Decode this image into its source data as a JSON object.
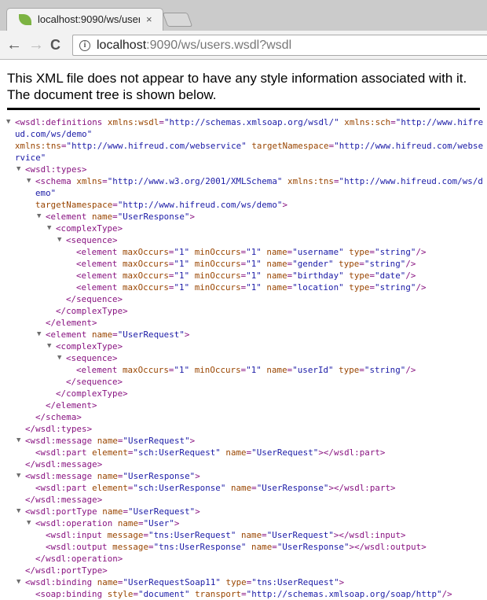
{
  "browser": {
    "tab_title": "localhost:9090/ws/user",
    "tab_close": "×",
    "back_icon": "←",
    "forward_icon": "→",
    "reload_icon": "C",
    "url_host": "localhost",
    "url_rest": ":9090/ws/users.wsdl?wsdl",
    "info_icon": "i"
  },
  "notice": "This XML file does not appear to have any style information associated with it. The document tree is shown below.",
  "colors": {
    "tag": "#881280",
    "attr": "#994500",
    "value": "#1a1aa6"
  },
  "xml_lines": [
    {
      "d": 0,
      "o": 1,
      "p": [
        [
          "tag",
          "<wsdl:definitions "
        ],
        [
          "attr",
          "xmlns:wsdl"
        ],
        [
          "tag",
          "="
        ],
        [
          "val",
          "\"http://schemas.xmlsoap.org/wsdl/\""
        ],
        [
          "tag",
          " "
        ],
        [
          "attr",
          "xmlns:sch"
        ],
        [
          "tag",
          "="
        ],
        [
          "val",
          "\"http://www.hifreud.com/ws/demo\""
        ]
      ]
    },
    {
      "d": 0,
      "p": [
        [
          "attr",
          "xmlns:tns"
        ],
        [
          "tag",
          "="
        ],
        [
          "val",
          "\"http://www.hifreud.com/webservice\""
        ],
        [
          "tag",
          " "
        ],
        [
          "attr",
          "targetNamespace"
        ],
        [
          "tag",
          "="
        ],
        [
          "val",
          "\"http://www.hifreud.com/webservice\""
        ]
      ]
    },
    {
      "d": 1,
      "o": 1,
      "p": [
        [
          "tag",
          "<wsdl:types>"
        ]
      ]
    },
    {
      "d": 2,
      "o": 1,
      "p": [
        [
          "tag",
          "<schema "
        ],
        [
          "attr",
          "xmlns"
        ],
        [
          "tag",
          "="
        ],
        [
          "val",
          "\"http://www.w3.org/2001/XMLSchema\""
        ],
        [
          "tag",
          " "
        ],
        [
          "attr",
          "xmlns:tns"
        ],
        [
          "tag",
          "="
        ],
        [
          "val",
          "\"http://www.hifreud.com/ws/demo\""
        ]
      ]
    },
    {
      "d": 2,
      "p": [
        [
          "attr",
          "targetNamespace"
        ],
        [
          "tag",
          "="
        ],
        [
          "val",
          "\"http://www.hifreud.com/ws/demo\""
        ],
        [
          "tag",
          ">"
        ]
      ]
    },
    {
      "d": 3,
      "o": 1,
      "p": [
        [
          "tag",
          "<element "
        ],
        [
          "attr",
          "name"
        ],
        [
          "tag",
          "="
        ],
        [
          "val",
          "\"UserResponse\""
        ],
        [
          "tag",
          ">"
        ]
      ]
    },
    {
      "d": 4,
      "o": 1,
      "p": [
        [
          "tag",
          "<complexType>"
        ]
      ]
    },
    {
      "d": 5,
      "o": 1,
      "p": [
        [
          "tag",
          "<sequence>"
        ]
      ]
    },
    {
      "d": 6,
      "p": [
        [
          "tag",
          "<element "
        ],
        [
          "attr",
          "maxOccurs"
        ],
        [
          "tag",
          "="
        ],
        [
          "val",
          "\"1\""
        ],
        [
          "tag",
          " "
        ],
        [
          "attr",
          "minOccurs"
        ],
        [
          "tag",
          "="
        ],
        [
          "val",
          "\"1\""
        ],
        [
          "tag",
          " "
        ],
        [
          "attr",
          "name"
        ],
        [
          "tag",
          "="
        ],
        [
          "val",
          "\"username\""
        ],
        [
          "tag",
          " "
        ],
        [
          "attr",
          "type"
        ],
        [
          "tag",
          "="
        ],
        [
          "val",
          "\"string\""
        ],
        [
          "tag",
          "/>"
        ]
      ]
    },
    {
      "d": 6,
      "p": [
        [
          "tag",
          "<element "
        ],
        [
          "attr",
          "maxOccurs"
        ],
        [
          "tag",
          "="
        ],
        [
          "val",
          "\"1\""
        ],
        [
          "tag",
          " "
        ],
        [
          "attr",
          "minOccurs"
        ],
        [
          "tag",
          "="
        ],
        [
          "val",
          "\"1\""
        ],
        [
          "tag",
          " "
        ],
        [
          "attr",
          "name"
        ],
        [
          "tag",
          "="
        ],
        [
          "val",
          "\"gender\""
        ],
        [
          "tag",
          " "
        ],
        [
          "attr",
          "type"
        ],
        [
          "tag",
          "="
        ],
        [
          "val",
          "\"string\""
        ],
        [
          "tag",
          "/>"
        ]
      ]
    },
    {
      "d": 6,
      "p": [
        [
          "tag",
          "<element "
        ],
        [
          "attr",
          "maxOccurs"
        ],
        [
          "tag",
          "="
        ],
        [
          "val",
          "\"1\""
        ],
        [
          "tag",
          " "
        ],
        [
          "attr",
          "minOccurs"
        ],
        [
          "tag",
          "="
        ],
        [
          "val",
          "\"1\""
        ],
        [
          "tag",
          " "
        ],
        [
          "attr",
          "name"
        ],
        [
          "tag",
          "="
        ],
        [
          "val",
          "\"birthday\""
        ],
        [
          "tag",
          " "
        ],
        [
          "attr",
          "type"
        ],
        [
          "tag",
          "="
        ],
        [
          "val",
          "\"date\""
        ],
        [
          "tag",
          "/>"
        ]
      ]
    },
    {
      "d": 6,
      "p": [
        [
          "tag",
          "<element "
        ],
        [
          "attr",
          "maxOccurs"
        ],
        [
          "tag",
          "="
        ],
        [
          "val",
          "\"1\""
        ],
        [
          "tag",
          " "
        ],
        [
          "attr",
          "minOccurs"
        ],
        [
          "tag",
          "="
        ],
        [
          "val",
          "\"1\""
        ],
        [
          "tag",
          " "
        ],
        [
          "attr",
          "name"
        ],
        [
          "tag",
          "="
        ],
        [
          "val",
          "\"location\""
        ],
        [
          "tag",
          " "
        ],
        [
          "attr",
          "type"
        ],
        [
          "tag",
          "="
        ],
        [
          "val",
          "\"string\""
        ],
        [
          "tag",
          "/>"
        ]
      ]
    },
    {
      "d": 5,
      "p": [
        [
          "tag",
          "</sequence>"
        ]
      ]
    },
    {
      "d": 4,
      "p": [
        [
          "tag",
          "</complexType>"
        ]
      ]
    },
    {
      "d": 3,
      "p": [
        [
          "tag",
          "</element>"
        ]
      ]
    },
    {
      "d": 3,
      "o": 1,
      "p": [
        [
          "tag",
          "<element "
        ],
        [
          "attr",
          "name"
        ],
        [
          "tag",
          "="
        ],
        [
          "val",
          "\"UserRequest\""
        ],
        [
          "tag",
          ">"
        ]
      ]
    },
    {
      "d": 4,
      "o": 1,
      "p": [
        [
          "tag",
          "<complexType>"
        ]
      ]
    },
    {
      "d": 5,
      "o": 1,
      "p": [
        [
          "tag",
          "<sequence>"
        ]
      ]
    },
    {
      "d": 6,
      "p": [
        [
          "tag",
          "<element "
        ],
        [
          "attr",
          "maxOccurs"
        ],
        [
          "tag",
          "="
        ],
        [
          "val",
          "\"1\""
        ],
        [
          "tag",
          " "
        ],
        [
          "attr",
          "minOccurs"
        ],
        [
          "tag",
          "="
        ],
        [
          "val",
          "\"1\""
        ],
        [
          "tag",
          " "
        ],
        [
          "attr",
          "name"
        ],
        [
          "tag",
          "="
        ],
        [
          "val",
          "\"userId\""
        ],
        [
          "tag",
          " "
        ],
        [
          "attr",
          "type"
        ],
        [
          "tag",
          "="
        ],
        [
          "val",
          "\"string\""
        ],
        [
          "tag",
          "/>"
        ]
      ]
    },
    {
      "d": 5,
      "p": [
        [
          "tag",
          "</sequence>"
        ]
      ]
    },
    {
      "d": 4,
      "p": [
        [
          "tag",
          "</complexType>"
        ]
      ]
    },
    {
      "d": 3,
      "p": [
        [
          "tag",
          "</element>"
        ]
      ]
    },
    {
      "d": 2,
      "p": [
        [
          "tag",
          "</schema>"
        ]
      ]
    },
    {
      "d": 1,
      "p": [
        [
          "tag",
          "</wsdl:types>"
        ]
      ]
    },
    {
      "d": 1,
      "o": 1,
      "p": [
        [
          "tag",
          "<wsdl:message "
        ],
        [
          "attr",
          "name"
        ],
        [
          "tag",
          "="
        ],
        [
          "val",
          "\"UserRequest\""
        ],
        [
          "tag",
          ">"
        ]
      ]
    },
    {
      "d": 2,
      "p": [
        [
          "tag",
          "<wsdl:part "
        ],
        [
          "attr",
          "element"
        ],
        [
          "tag",
          "="
        ],
        [
          "val",
          "\"sch:UserRequest\""
        ],
        [
          "tag",
          " "
        ],
        [
          "attr",
          "name"
        ],
        [
          "tag",
          "="
        ],
        [
          "val",
          "\"UserRequest\""
        ],
        [
          "tag",
          "></wsdl:part>"
        ]
      ]
    },
    {
      "d": 1,
      "p": [
        [
          "tag",
          "</wsdl:message>"
        ]
      ]
    },
    {
      "d": 1,
      "o": 1,
      "p": [
        [
          "tag",
          "<wsdl:message "
        ],
        [
          "attr",
          "name"
        ],
        [
          "tag",
          "="
        ],
        [
          "val",
          "\"UserResponse\""
        ],
        [
          "tag",
          ">"
        ]
      ]
    },
    {
      "d": 2,
      "p": [
        [
          "tag",
          "<wsdl:part "
        ],
        [
          "attr",
          "element"
        ],
        [
          "tag",
          "="
        ],
        [
          "val",
          "\"sch:UserResponse\""
        ],
        [
          "tag",
          " "
        ],
        [
          "attr",
          "name"
        ],
        [
          "tag",
          "="
        ],
        [
          "val",
          "\"UserResponse\""
        ],
        [
          "tag",
          "></wsdl:part>"
        ]
      ]
    },
    {
      "d": 1,
      "p": [
        [
          "tag",
          "</wsdl:message>"
        ]
      ]
    },
    {
      "d": 1,
      "o": 1,
      "p": [
        [
          "tag",
          "<wsdl:portType "
        ],
        [
          "attr",
          "name"
        ],
        [
          "tag",
          "="
        ],
        [
          "val",
          "\"UserRequest\""
        ],
        [
          "tag",
          ">"
        ]
      ]
    },
    {
      "d": 2,
      "o": 1,
      "p": [
        [
          "tag",
          "<wsdl:operation "
        ],
        [
          "attr",
          "name"
        ],
        [
          "tag",
          "="
        ],
        [
          "val",
          "\"User\""
        ],
        [
          "tag",
          ">"
        ]
      ]
    },
    {
      "d": 3,
      "p": [
        [
          "tag",
          "<wsdl:input "
        ],
        [
          "attr",
          "message"
        ],
        [
          "tag",
          "="
        ],
        [
          "val",
          "\"tns:UserRequest\""
        ],
        [
          "tag",
          " "
        ],
        [
          "attr",
          "name"
        ],
        [
          "tag",
          "="
        ],
        [
          "val",
          "\"UserRequest\""
        ],
        [
          "tag",
          "></wsdl:input>"
        ]
      ]
    },
    {
      "d": 3,
      "p": [
        [
          "tag",
          "<wsdl:output "
        ],
        [
          "attr",
          "message"
        ],
        [
          "tag",
          "="
        ],
        [
          "val",
          "\"tns:UserResponse\""
        ],
        [
          "tag",
          " "
        ],
        [
          "attr",
          "name"
        ],
        [
          "tag",
          "="
        ],
        [
          "val",
          "\"UserResponse\""
        ],
        [
          "tag",
          "></wsdl:output>"
        ]
      ]
    },
    {
      "d": 2,
      "p": [
        [
          "tag",
          "</wsdl:operation>"
        ]
      ]
    },
    {
      "d": 1,
      "p": [
        [
          "tag",
          "</wsdl:portType>"
        ]
      ]
    },
    {
      "d": 1,
      "o": 1,
      "p": [
        [
          "tag",
          "<wsdl:binding "
        ],
        [
          "attr",
          "name"
        ],
        [
          "tag",
          "="
        ],
        [
          "val",
          "\"UserRequestSoap11\""
        ],
        [
          "tag",
          " "
        ],
        [
          "attr",
          "type"
        ],
        [
          "tag",
          "="
        ],
        [
          "val",
          "\"tns:UserRequest\""
        ],
        [
          "tag",
          ">"
        ]
      ]
    },
    {
      "d": 2,
      "p": [
        [
          "tag",
          "<soap:binding "
        ],
        [
          "attr",
          "style"
        ],
        [
          "tag",
          "="
        ],
        [
          "val",
          "\"document\""
        ],
        [
          "tag",
          " "
        ],
        [
          "attr",
          "transport"
        ],
        [
          "tag",
          "="
        ],
        [
          "val",
          "\"http://schemas.xmlsoap.org/soap/http\""
        ],
        [
          "tag",
          "/>"
        ]
      ]
    }
  ]
}
